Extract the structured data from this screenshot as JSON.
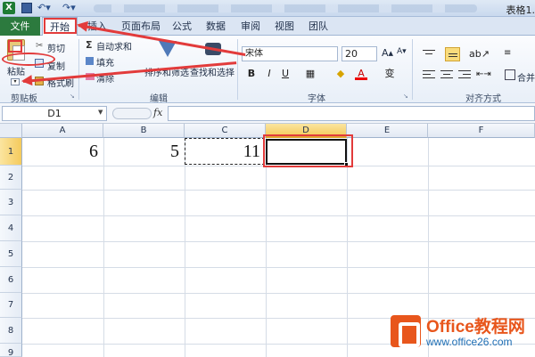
{
  "window": {
    "title": "表格1."
  },
  "tabs": [
    {
      "label": "文件"
    },
    {
      "label": "开始"
    },
    {
      "label": "插入"
    },
    {
      "label": "页面布局"
    },
    {
      "label": "公式"
    },
    {
      "label": "数据"
    },
    {
      "label": "审阅"
    },
    {
      "label": "视图"
    },
    {
      "label": "团队"
    }
  ],
  "clipboard": {
    "paste": "粘贴",
    "cut": "剪切",
    "copy": "复制",
    "format_painter": "格式刷",
    "group": "剪贴板"
  },
  "editing": {
    "autosum": "自动求和",
    "fill": "填充",
    "clear": "清除",
    "sort_filter": "排序和筛选",
    "find_select": "查找和选择",
    "group": "编辑"
  },
  "font": {
    "name": "宋体",
    "size": "20",
    "bold": "B",
    "italic": "I",
    "underline": "U",
    "phonetic": "变",
    "font_color_letter": "A",
    "group": "字体"
  },
  "alignment": {
    "merge": "合并",
    "group": "对齐方式"
  },
  "formula_bar": {
    "name_box": "D1",
    "fx": "fx",
    "formula": ""
  },
  "grid": {
    "columns": [
      "A",
      "B",
      "C",
      "D",
      "E",
      "F"
    ],
    "rows": [
      "1",
      "2",
      "3",
      "4",
      "5",
      "6",
      "7",
      "8",
      "9"
    ],
    "cells": {
      "A1": "6",
      "B1": "5",
      "C1": "11",
      "D1": ""
    }
  },
  "watermark": {
    "brand": "Office教程网",
    "url": "www.office26.com"
  },
  "colors": {
    "file_tab": "#2c7a3e",
    "annotation": "#e23b3b",
    "active_header": "#f4ca5c"
  }
}
